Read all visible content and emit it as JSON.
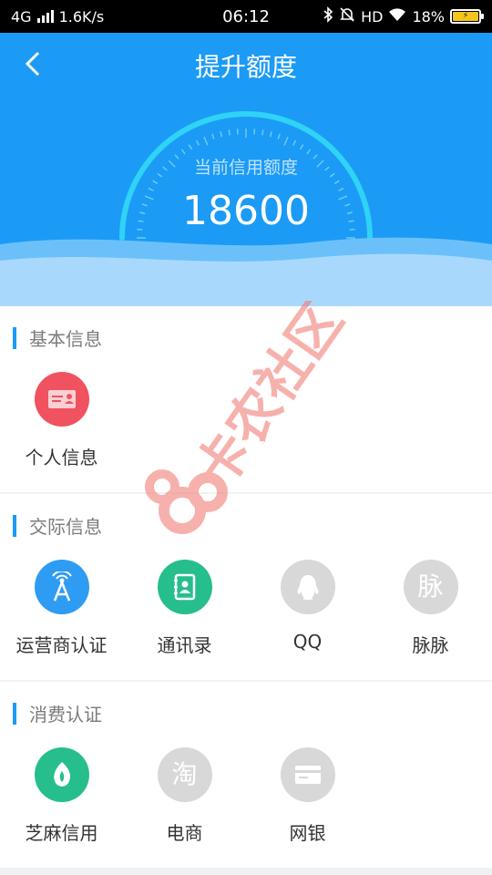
{
  "status_bar": {
    "network": "4G",
    "speed": "1.6K/s",
    "time": "06:12",
    "hd": "HD",
    "battery": "18%"
  },
  "header": {
    "title": "提升额度",
    "credit_label": "当前信用额度",
    "credit_value": "18600"
  },
  "sections": [
    {
      "title": "基本信息",
      "items": [
        {
          "label": "个人信息",
          "icon": "id-card-icon",
          "color": "#f0525f"
        }
      ]
    },
    {
      "title": "交际信息",
      "items": [
        {
          "label": "运营商认证",
          "icon": "signal-tower-icon",
          "color": "#2e9cf3"
        },
        {
          "label": "通讯录",
          "icon": "contacts-book-icon",
          "color": "#26be8c"
        },
        {
          "label": "QQ",
          "icon": "qq-penguin-icon",
          "color": "#d8d8d8"
        },
        {
          "label": "脉脉",
          "icon": "maimai-icon",
          "icon_text": "脉",
          "color": "#d8d8d8"
        }
      ]
    },
    {
      "title": "消费认证",
      "items": [
        {
          "label": "芝麻信用",
          "icon": "sesame-icon",
          "color": "#26be8c"
        },
        {
          "label": "电商",
          "icon": "taobao-icon",
          "icon_text": "淘",
          "color": "#d8d8d8"
        },
        {
          "label": "网银",
          "icon": "bank-card-icon",
          "color": "#d8d8d8"
        }
      ]
    }
  ],
  "watermark": "卡农社区",
  "colors": {
    "primary": "#1b9bf5",
    "gauge_arc": "#2fd3f5",
    "page_bg": "#f0f1f3"
  }
}
